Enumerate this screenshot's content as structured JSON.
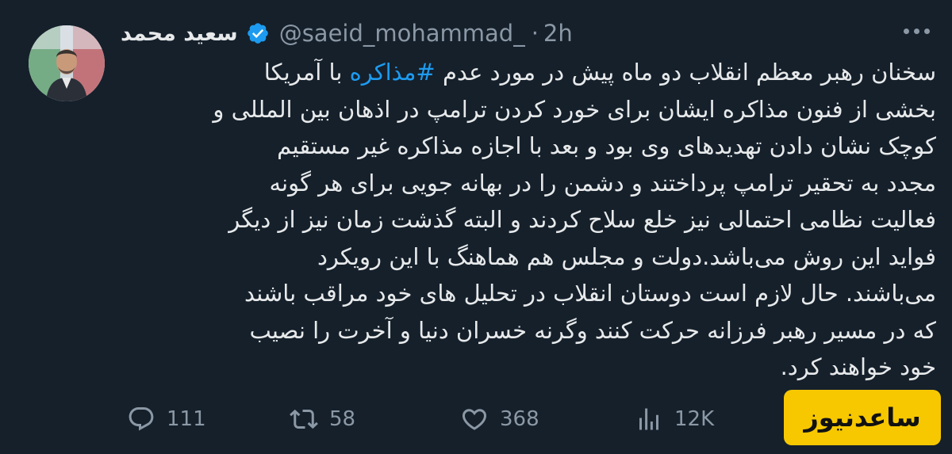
{
  "tweet": {
    "author": {
      "display_name": "سعید محمد",
      "handle": "@saeid_mohammad_",
      "verified": true,
      "avatar_icon": "profile-photo"
    },
    "separator": "·",
    "time": "2h",
    "text": {
      "line_1_pre": "سخنان رهبر معظم انقلاب دو ماه پیش در مورد عدم ",
      "hashtag": "#مذاکره",
      "line_1_post": " با آمریکا",
      "line_2": "بخشی از فنون مذاکره ایشان برای خورد کردن ترامپ در اذهان بین المللی و",
      "line_3": "کوچک نشان دادن تهدیدهای وی بود و بعد با اجازه مذاکره غیر مستقیم",
      "line_4": "مجدد به تحقیر ترامپ پرداختند و دشمن را در بهانه جویی برای هر گونه",
      "line_5": "فعالیت نظامی احتمالی نیز خلع سلاح کردند و البته گذشت زمان نیز از دیگر",
      "line_6": "فواید این روش می‌باشد.دولت و مجلس هم هماهنگ با این رویکرد",
      "line_7": "می‌باشند. حال لازم است دوستان انقلاب در تحلیل های خود مراقب باشند",
      "line_8": "که در مسیر رهبر فرزانه حرکت کنند وگرنه خسران دنیا و آخرت را نصیب",
      "line_9": "خود خواهند کرد."
    },
    "actions": {
      "replies": "111",
      "retweets": "58",
      "likes": "368",
      "views": "12K"
    },
    "colors": {
      "background": "#15202b",
      "text": "#e7e9ea",
      "muted": "#8b98a5",
      "accent": "#1d9bf0",
      "watermark_bg": "#f7c800"
    }
  },
  "watermark": {
    "text": "ساعدنیوز"
  }
}
